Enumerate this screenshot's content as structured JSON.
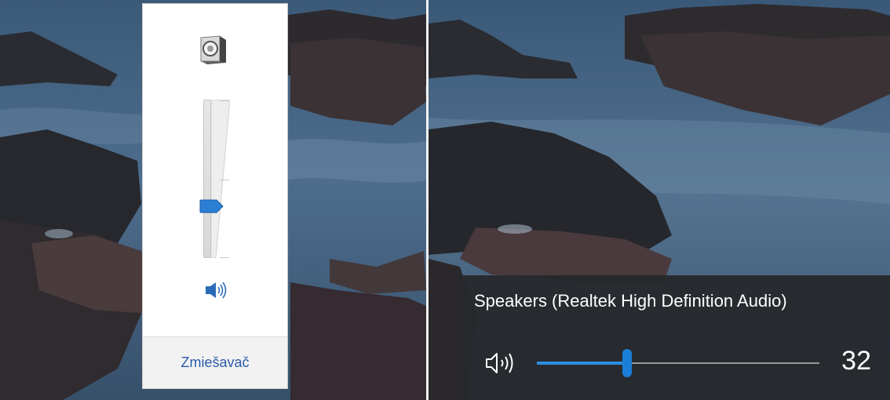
{
  "left_flyout": {
    "mixer_link": "Zmiešavač",
    "icons": {
      "device": "speaker-device-icon",
      "mute": "speaker-volume-icon"
    },
    "volume_fraction": 0.32,
    "accent_color": "#2b7fd4"
  },
  "right_flyout": {
    "device_name": "Speakers (Realtek High Definition Audio)",
    "volume_level": "32",
    "volume_fraction": 0.32,
    "icons": {
      "speaker": "speaker-volume-icon"
    },
    "accent_color": "#1a7fd8",
    "background_color": "#26292d"
  }
}
